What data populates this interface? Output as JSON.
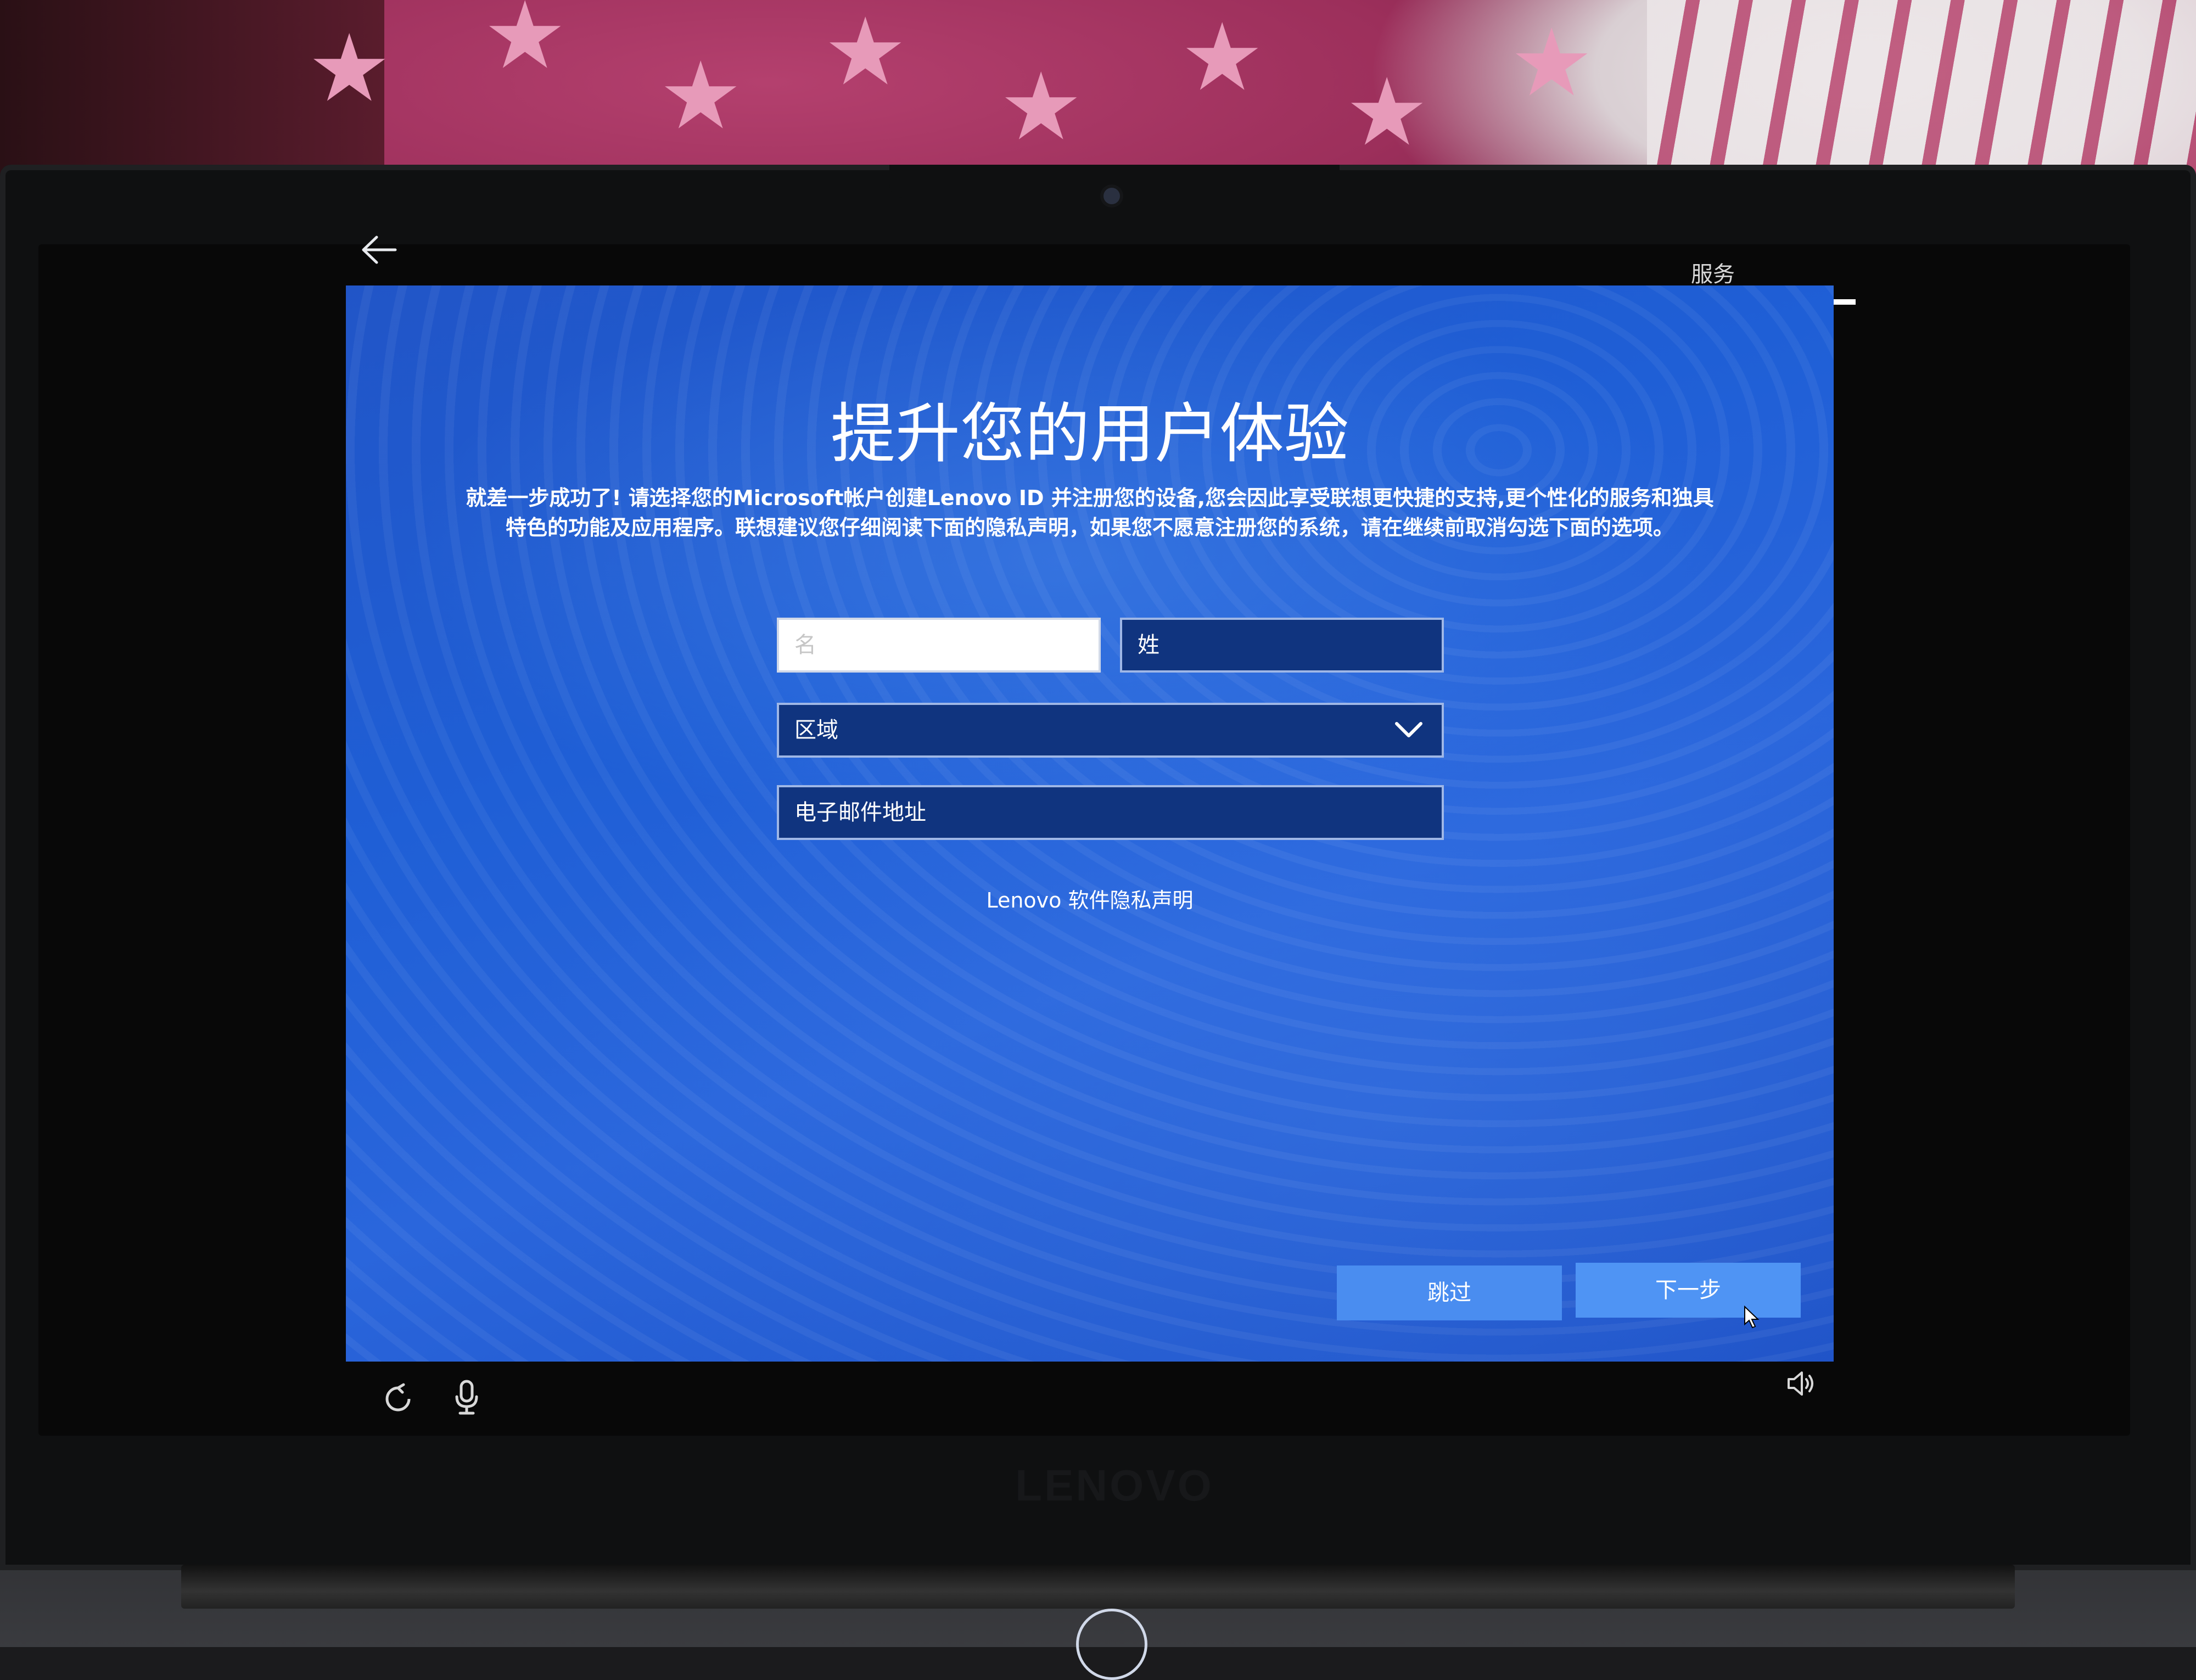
{
  "header": {
    "back_icon": "back-arrow-icon",
    "tab_label": "服务"
  },
  "main": {
    "title": "提升您的用户体验",
    "description": "就差一步成功了! 请选择您的Microsoft帐户创建Lenovo ID 并注册您的设备,您会因此享受联想更快捷的支持,更个性化的服务和独具特色的功能及应用程序。联想建议您仔细阅读下面的隐私声明，如果您不愿意注册您的系统，请在继续前取消勾选下面的选项。",
    "form": {
      "first_name_placeholder": "名",
      "first_name_value": "",
      "last_name_placeholder": "姓",
      "region_label": "区域",
      "email_placeholder": "电子邮件地址"
    },
    "privacy_link": "Lenovo 软件隐私声明"
  },
  "footer": {
    "skip_label": "跳过",
    "next_label": "下一步",
    "ease_of_access_icon": "ease-of-access-icon",
    "microphone_icon": "microphone-icon",
    "volume_icon": "volume-icon"
  },
  "device": {
    "brand_text": "LENOVO"
  },
  "colors": {
    "panel_blue": "#1f5fd6",
    "button_blue": "#4a8df0",
    "field_dark": "#10347f"
  }
}
